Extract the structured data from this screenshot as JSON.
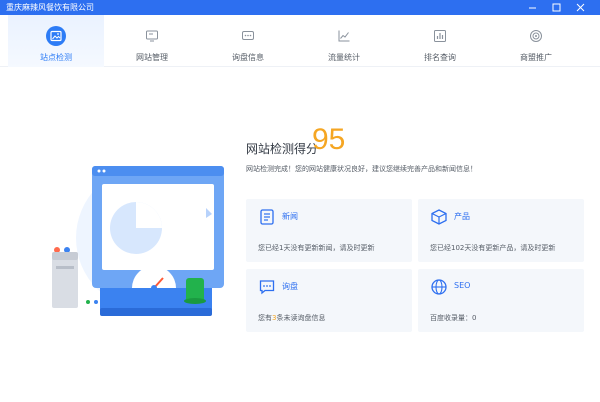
{
  "window": {
    "title": "重庆麻辣风餐饮有限公司",
    "controls": {
      "minimize_icon": "minimize-icon",
      "maximize_icon": "maximize-icon",
      "close_icon": "close-icon"
    }
  },
  "tabs": [
    {
      "label": "站点检测",
      "icon": "picture-icon",
      "active": true
    },
    {
      "label": "网站管理",
      "icon": "monitor-icon",
      "active": false
    },
    {
      "label": "询盘信息",
      "icon": "chat-icon",
      "active": false
    },
    {
      "label": "流量统计",
      "icon": "line-chart-icon",
      "active": false
    },
    {
      "label": "排名查询",
      "icon": "bar-chart-icon",
      "active": false
    },
    {
      "label": "商盟推广",
      "icon": "target-icon",
      "active": false
    }
  ],
  "score": {
    "label": "网站检测得分",
    "value": "95",
    "description": "网站检测完成！您的网站健康状况良好，建议您继续完善产品和新闻信息！"
  },
  "cards": {
    "news": {
      "title": "新闻",
      "text": "您已经1天没有更新新闻，请及时更新",
      "icon": "document-icon"
    },
    "product": {
      "title": "产品",
      "text": "您已经102天没有更新产品，请及时更新",
      "icon": "box-icon"
    },
    "inquiry": {
      "title": "询盘",
      "text_prefix": "您有",
      "text_count": "3",
      "text_suffix": "条未读询盘信息",
      "icon": "message-icon"
    },
    "seo": {
      "title": "SEO",
      "text": "百度收录量：0",
      "icon": "globe-icon"
    }
  },
  "colors": {
    "accent": "#2d6ff0",
    "score": "#f5a623",
    "card_bg": "#f4f7fb"
  }
}
